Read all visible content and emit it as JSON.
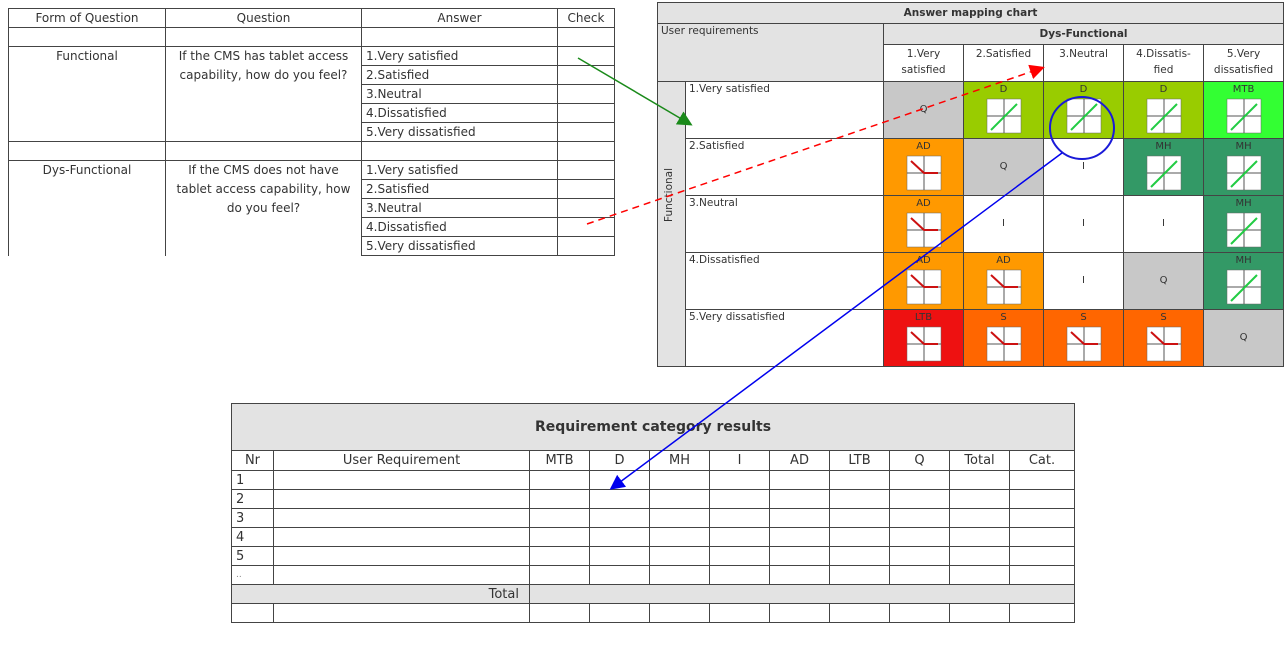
{
  "questionnaire": {
    "headers": [
      "Form of Question",
      "Question",
      "Answer",
      "Check"
    ],
    "groups": [
      {
        "form": "Functional",
        "question": "If the CMS has tablet access capability, how do you feel?",
        "answers": [
          "1.Very satisfied",
          "2.Satisfied",
          "3.Neutral",
          "4.Dissatisfied",
          "5.Very dissatisfied"
        ]
      },
      {
        "form": "Dys-Functional",
        "question": "If the CMS does not have tablet access capability, how do you feel?",
        "answers": [
          "1.Very satisfied",
          "2.Satisfied",
          "3.Neutral",
          "4.Dissatisfied",
          "5.Very dissatisfied"
        ]
      }
    ]
  },
  "mapping": {
    "title": "Answer mapping chart",
    "corner_label": "User requirements",
    "dys_label": "Dys-Functional",
    "functional_label": "Functional",
    "columns": [
      "1.Very satisfied",
      "2.Satisfied",
      "3.Neutral",
      "4.Dissatis-fied",
      "5.Very dissatisfied"
    ],
    "rows": [
      {
        "label": "1.Very satisfied",
        "cells": [
          {
            "code": "Q",
            "color": "#c8c8c8",
            "icon": "none"
          },
          {
            "code": "D",
            "color": "#99cc00",
            "icon": "rise"
          },
          {
            "code": "D",
            "color": "#99cc00",
            "icon": "rise"
          },
          {
            "code": "D",
            "color": "#99cc00",
            "icon": "rise"
          },
          {
            "code": "MTB",
            "color": "#33ff33",
            "icon": "rise"
          }
        ]
      },
      {
        "label": "2.Satisfied",
        "cells": [
          {
            "code": "AD",
            "color": "#ff9900",
            "icon": "fall"
          },
          {
            "code": "Q",
            "color": "#c8c8c8",
            "icon": "none"
          },
          {
            "code": "I",
            "color": "#ffffff",
            "icon": "none"
          },
          {
            "code": "MH",
            "color": "#339966",
            "icon": "rise"
          },
          {
            "code": "MH",
            "color": "#339966",
            "icon": "rise"
          }
        ]
      },
      {
        "label": "3.Neutral",
        "cells": [
          {
            "code": "AD",
            "color": "#ff9900",
            "icon": "fall"
          },
          {
            "code": "I",
            "color": "#ffffff",
            "icon": "none"
          },
          {
            "code": "I",
            "color": "#ffffff",
            "icon": "none"
          },
          {
            "code": "I",
            "color": "#ffffff",
            "icon": "none"
          },
          {
            "code": "MH",
            "color": "#339966",
            "icon": "rise"
          }
        ]
      },
      {
        "label": "4.Dissatisfied",
        "cells": [
          {
            "code": "AD",
            "color": "#ff9900",
            "icon": "fall"
          },
          {
            "code": "AD",
            "color": "#ff9900",
            "icon": "fall"
          },
          {
            "code": "I",
            "color": "#ffffff",
            "icon": "none"
          },
          {
            "code": "Q",
            "color": "#c8c8c8",
            "icon": "none"
          },
          {
            "code": "MH",
            "color": "#339966",
            "icon": "rise"
          }
        ]
      },
      {
        "label": "5.Very dissatisfied",
        "cells": [
          {
            "code": "LTB",
            "color": "#ee1111",
            "icon": "fall"
          },
          {
            "code": "S",
            "color": "#ff6600",
            "icon": "fall"
          },
          {
            "code": "S",
            "color": "#ff6600",
            "icon": "fall"
          },
          {
            "code": "S",
            "color": "#ff6600",
            "icon": "fall"
          },
          {
            "code": "Q",
            "color": "#c8c8c8",
            "icon": "none"
          }
        ]
      }
    ]
  },
  "results": {
    "title": "Requirement category results",
    "headers": [
      "Nr",
      "User Requirement",
      "MTB",
      "D",
      "MH",
      "I",
      "AD",
      "LTB",
      "Q",
      "Total",
      "Cat."
    ],
    "rows": [
      "1",
      "2",
      "3",
      "4",
      "5",
      ".."
    ],
    "total_label": "Total"
  },
  "colors": {
    "green_arrow": "#1a8a1a",
    "red_arrow": "#ff0000",
    "blue_arrow": "#0000ee"
  }
}
